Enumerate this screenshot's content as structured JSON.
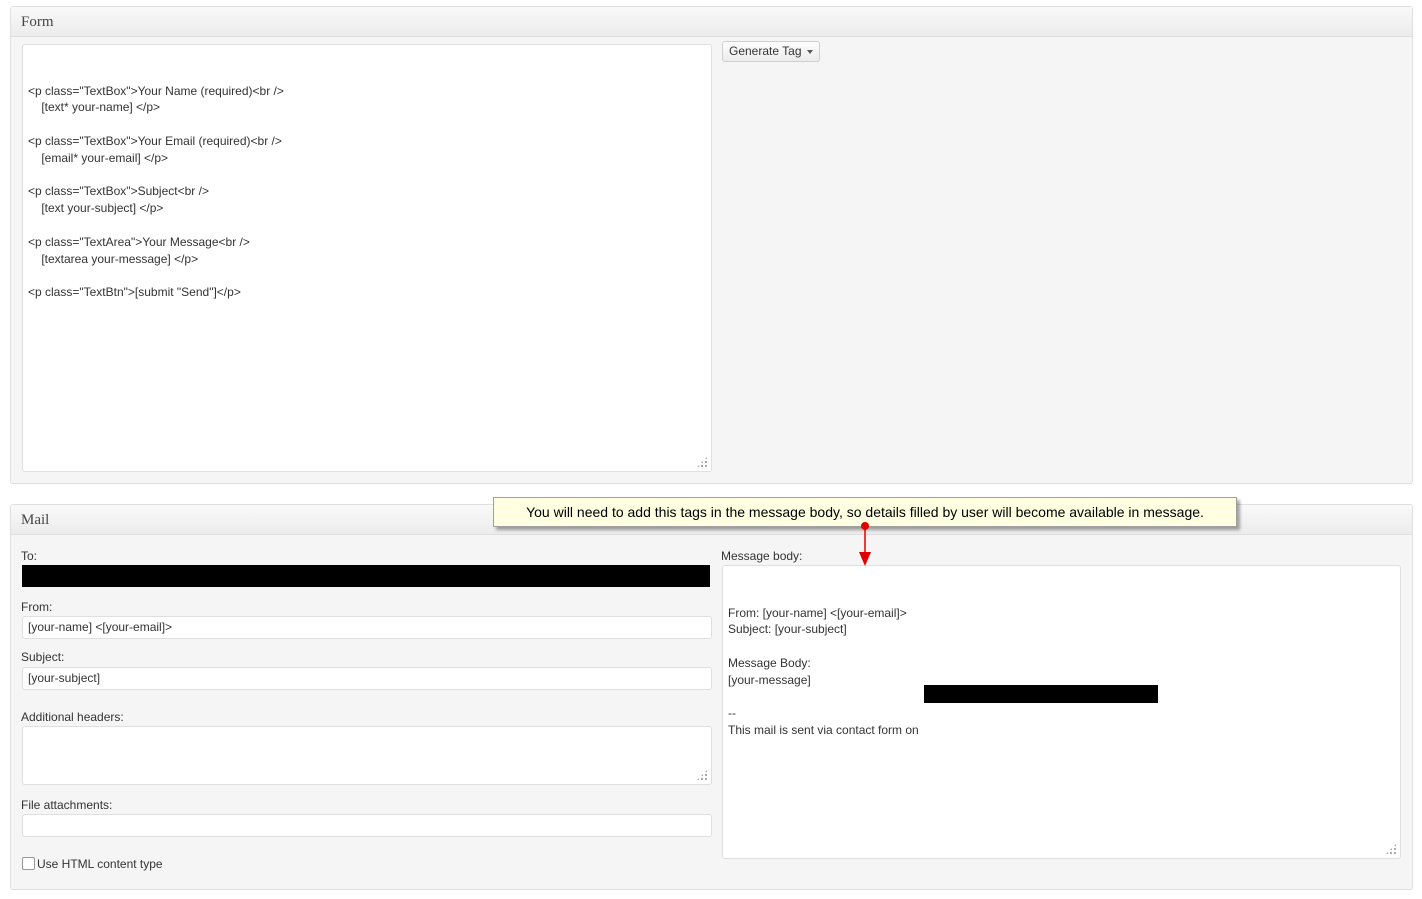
{
  "form_panel": {
    "title": "Form",
    "code_lines": [
      "<p class=\"TextBox\">Your Name (required)<br />",
      "    [text* your-name] </p>",
      "",
      "<p class=\"TextBox\">Your Email (required)<br />",
      "    [email* your-email] </p>",
      "",
      "<p class=\"TextBox\">Subject<br />",
      "    [text your-subject] </p>",
      "",
      "<p class=\"TextArea\">Your Message<br />",
      "    [textarea your-message] </p>",
      "",
      "<p class=\"TextBtn\">[submit \"Send\"]</p>"
    ],
    "generate_tag_label": "Generate Tag"
  },
  "mail_panel": {
    "title": "Mail",
    "to_label": "To:",
    "from_label": "From:",
    "from_value": "[your-name] <[your-email]>",
    "subject_label": "Subject:",
    "subject_value": "[your-subject]",
    "additional_headers_label": "Additional headers:",
    "file_attachments_label": "File attachments:",
    "html_content_label": "Use HTML content type",
    "message_body_label": "Message body:",
    "message_body_lines": [
      "From: [your-name] <[your-email]>",
      "Subject: [your-subject]",
      "",
      "Message Body:",
      "[your-message]",
      "",
      "--",
      "This mail is sent via contact form on"
    ]
  },
  "callout": {
    "text": "You will need to add this tags in the message body, so details filled by user will become available in message.",
    "arrow_color": "#e00000"
  },
  "icons": {
    "dropdown": "chevron-down-icon",
    "resize": "resize-grip-icon",
    "arrow": "red-arrow-icon"
  }
}
